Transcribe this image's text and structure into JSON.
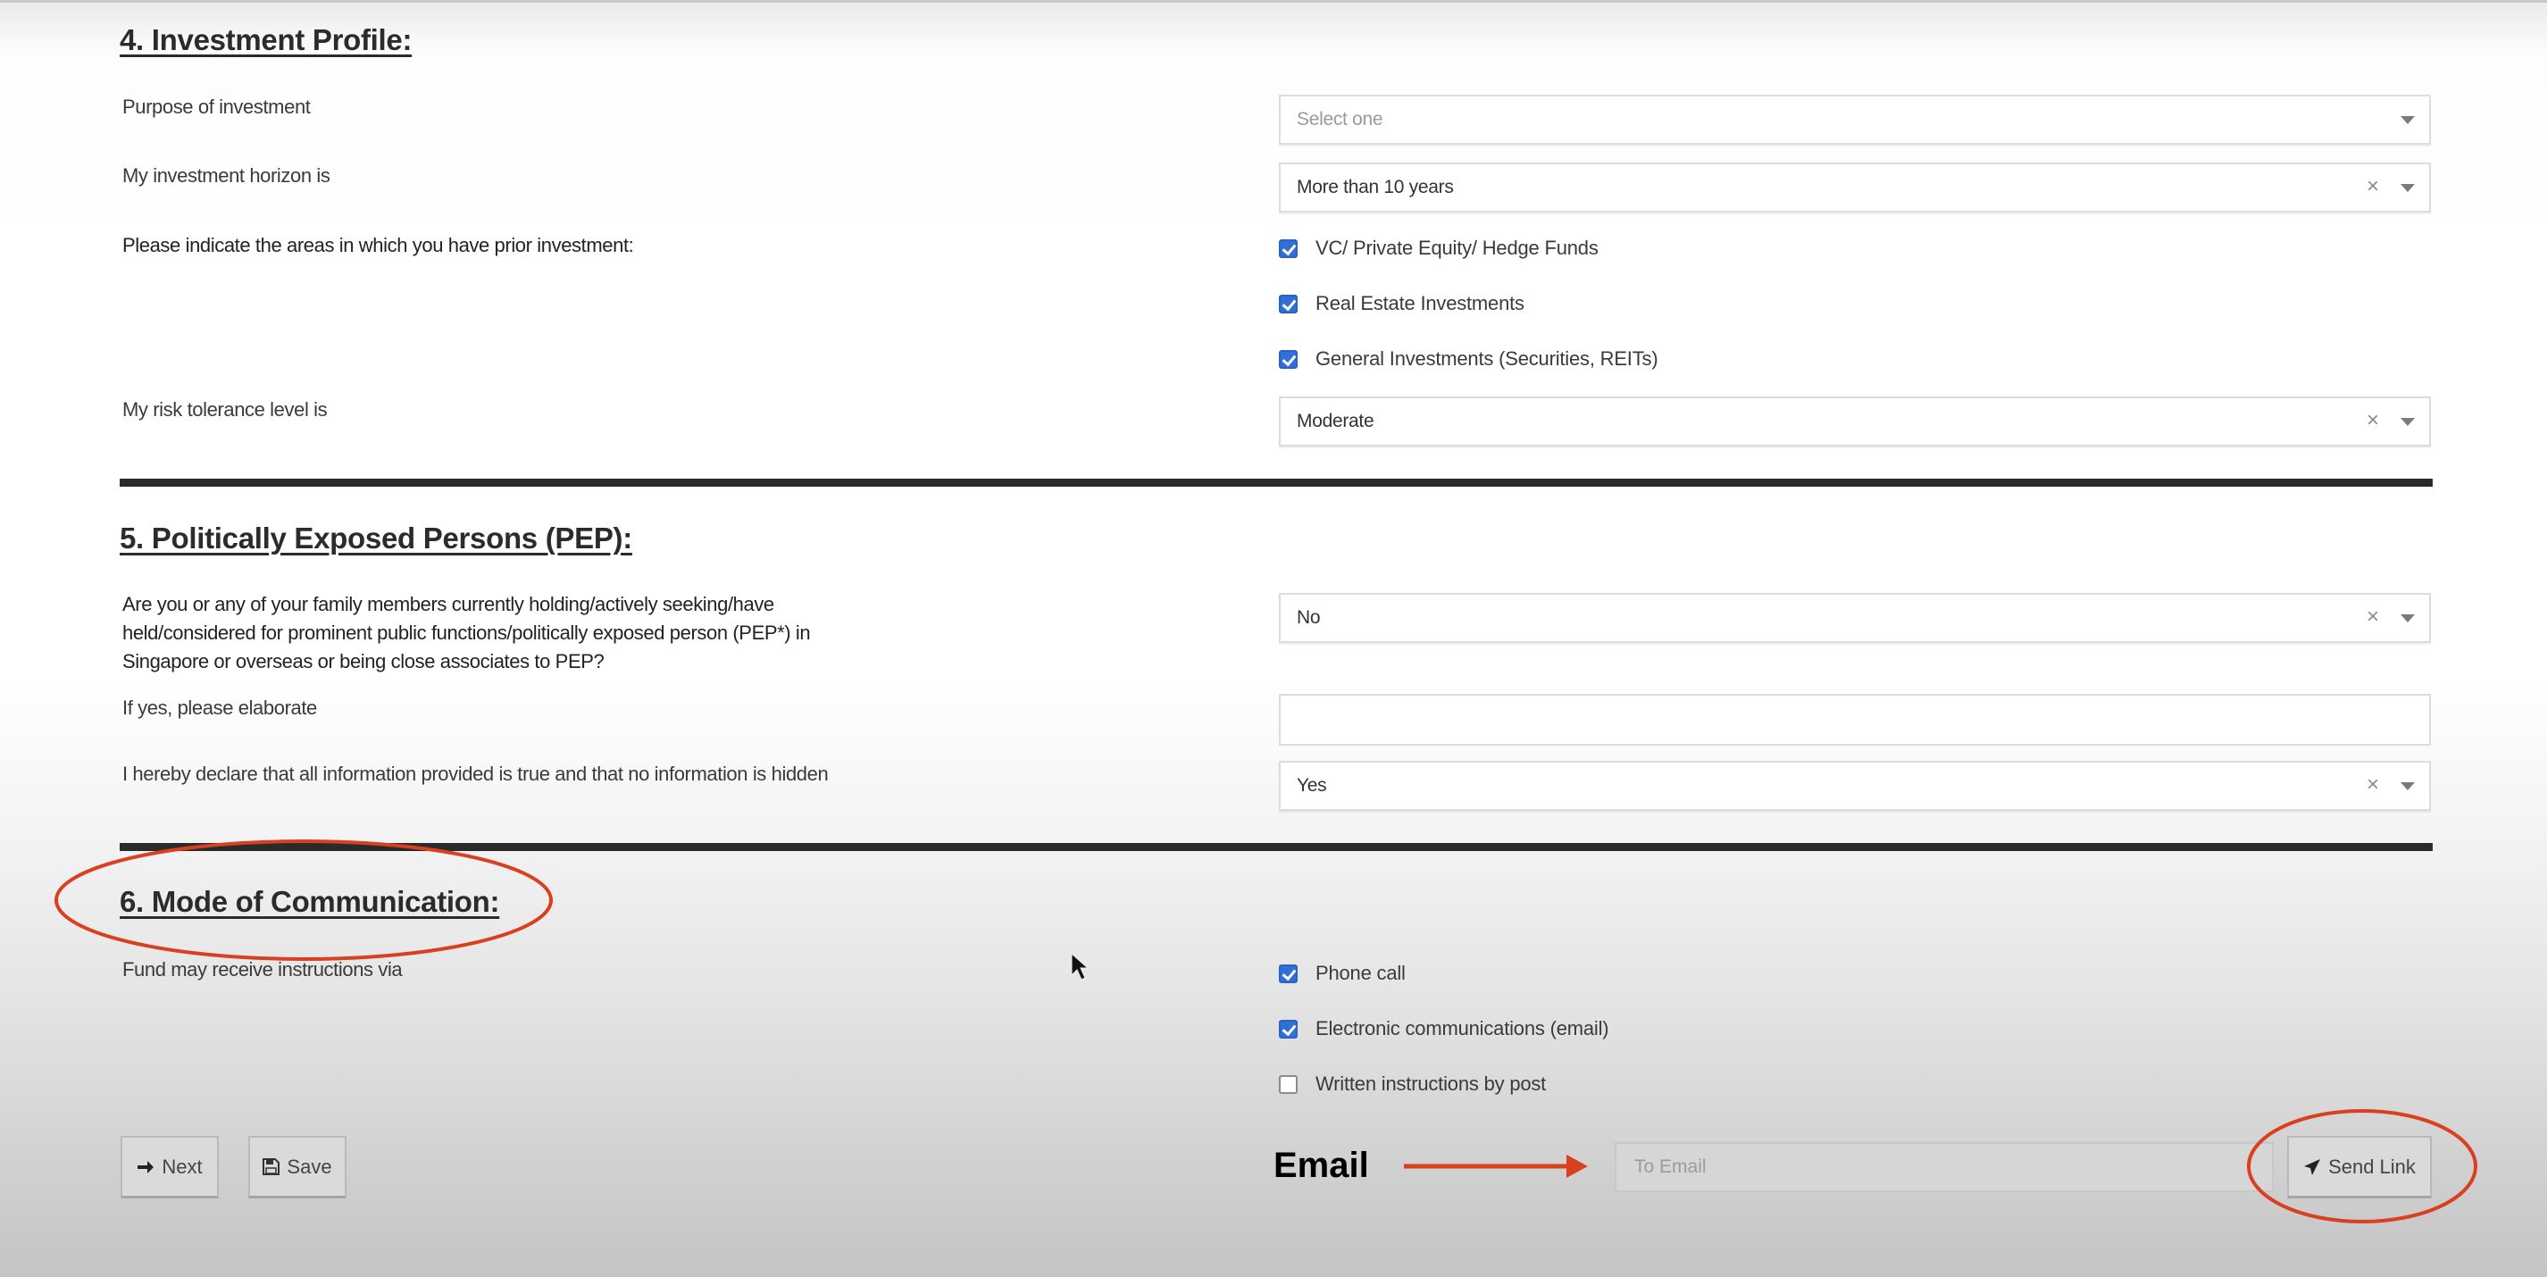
{
  "section4": {
    "heading": "4. Investment Profile:",
    "purpose": {
      "label": "Purpose of investment",
      "placeholder": "Select one",
      "value": ""
    },
    "horizon": {
      "label": "My investment horizon is",
      "value": "More than 10 years"
    },
    "prior_investment": {
      "label": "Please indicate the areas in which you have prior investment:",
      "options": [
        {
          "label": "VC/ Private Equity/ Hedge Funds",
          "checked": true
        },
        {
          "label": "Real Estate Investments",
          "checked": true
        },
        {
          "label": "General Investments (Securities, REITs)",
          "checked": true
        }
      ]
    },
    "risk": {
      "label": "My risk tolerance level is",
      "value": "Moderate"
    }
  },
  "section5": {
    "heading": "5. Politically Exposed Persons (PEP):",
    "pep_question": {
      "label": "Are you or any of your family members currently holding/actively seeking/have held/considered for prominent public functions/politically exposed person (PEP*) in Singapore or overseas or being close associates to PEP?",
      "value": "No"
    },
    "elaborate": {
      "label": "If yes, please elaborate",
      "value": ""
    },
    "declare": {
      "label": "I hereby declare that all information provided is true and that no information is hidden",
      "value": "Yes"
    }
  },
  "section6": {
    "heading": "6. Mode of Communication:",
    "instructions": {
      "label": "Fund may receive instructions via",
      "options": [
        {
          "label": "Phone call",
          "checked": true
        },
        {
          "label": "Electronic communications (email)",
          "checked": true
        },
        {
          "label": "Written instructions by post",
          "checked": false
        }
      ]
    }
  },
  "actions": {
    "next_label": "Next",
    "save_label": "Save",
    "email_placeholder": "To Email",
    "email_value": "",
    "send_link_label": "Send Link"
  },
  "icons": {
    "clear": "×",
    "next": "arrow-right-icon",
    "save": "floppy-disk-icon",
    "send": "paper-plane-icon"
  },
  "annotations": {
    "email_label": "Email",
    "color": "#d9401f"
  }
}
